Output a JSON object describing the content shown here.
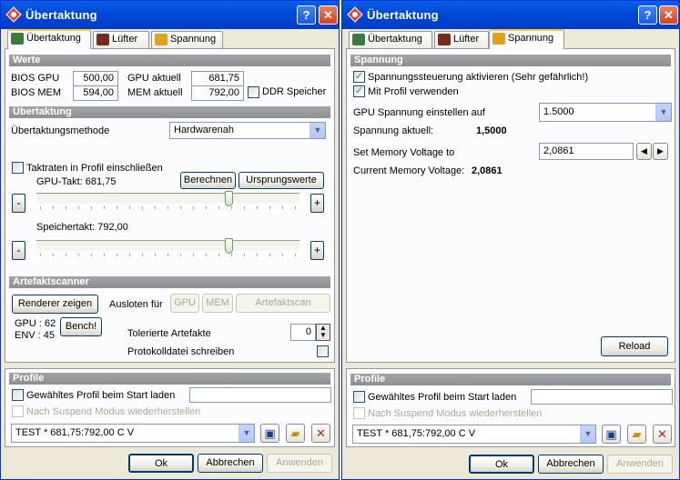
{
  "window": {
    "title": "Übertaktung",
    "help_label": "?",
    "close_label": "✕"
  },
  "tabs": [
    {
      "label": "Übertaktung",
      "icon": "chip-icon"
    },
    {
      "label": "Lüfter",
      "icon": "fan-icon"
    },
    {
      "label": "Spannung",
      "icon": "voltage-icon"
    }
  ],
  "left": {
    "werte": {
      "title": "Werte",
      "bios_gpu_label": "BIOS GPU",
      "bios_gpu_value": "500,00",
      "gpu_aktuell_label": "GPU aktuell",
      "gpu_aktuell_value": "681,75",
      "bios_mem_label": "BIOS MEM",
      "bios_mem_value": "594,00",
      "mem_aktuell_label": "MEM aktuell",
      "mem_aktuell_value": "792,00",
      "ddr_label": "DDR Speicher"
    },
    "uebertaktung": {
      "title": "Übertaktung",
      "methode_label": "Übertaktungsmethode",
      "methode_value": "Hardwarenah",
      "taktraten_label": "Taktraten in Profil einschließen",
      "gpu_takt_label": "GPU-Takt: 681,75",
      "berechnen_label": "Berechnen",
      "ursprungswerte_label": "Ursprungswerte",
      "speichertakt_label": "Speichertakt: 792,00",
      "minus_label": "-",
      "plus_label": "+",
      "gpu_slider_level": 0.74,
      "mem_slider_level": 0.74
    },
    "artefakt": {
      "title": "Artefaktscanner",
      "renderer_label": "Renderer zeigen",
      "ausloten_label": "Ausloten für",
      "gpu_btn": "GPU",
      "mem_btn": "MEM",
      "scan_btn": "Artefaktscan",
      "gpu_temp": "GPU : 62",
      "env_temp": "ENV : 45",
      "bench_label": "Bench!",
      "tolerierte_label": "Tolerierte Artefakte",
      "tolerierte_value": "0",
      "protokoll_label": "Protokolldatei schreiben"
    }
  },
  "right": {
    "spannung": {
      "title": "Spannung",
      "steuerung_label": "Spannungssteuerung aktivieren (Sehr gefährlich!)",
      "profil_label": "Mit Profil verwenden",
      "gpu_spannung_label": "GPU Spannung einstellen auf",
      "gpu_spannung_value": "1.5000",
      "spannung_aktuell_label": "Spannung aktuell:",
      "spannung_aktuell_value": "1,5000",
      "set_mem_label": "Set Memory Voltage to",
      "set_mem_value": "2,0861",
      "current_mem_label": "Current Memory Voltage:",
      "current_mem_value": "2,0861",
      "reload_label": "Reload"
    }
  },
  "profile": {
    "title": "Profile",
    "start_label": "Gewähltes Profil beim Start laden",
    "suspend_label": "Nach Suspend Modus wiederherstellen",
    "selected": "TEST * 681,75:792,00 C   V"
  },
  "footer": {
    "ok": "Ok",
    "abbrechen": "Abbrechen",
    "anwenden": "Anwenden"
  },
  "colors": {
    "titlebar": "#0048d8",
    "section": "#8e8f93",
    "active_tab_border": "#ffc83c",
    "delete": "#d01818"
  }
}
